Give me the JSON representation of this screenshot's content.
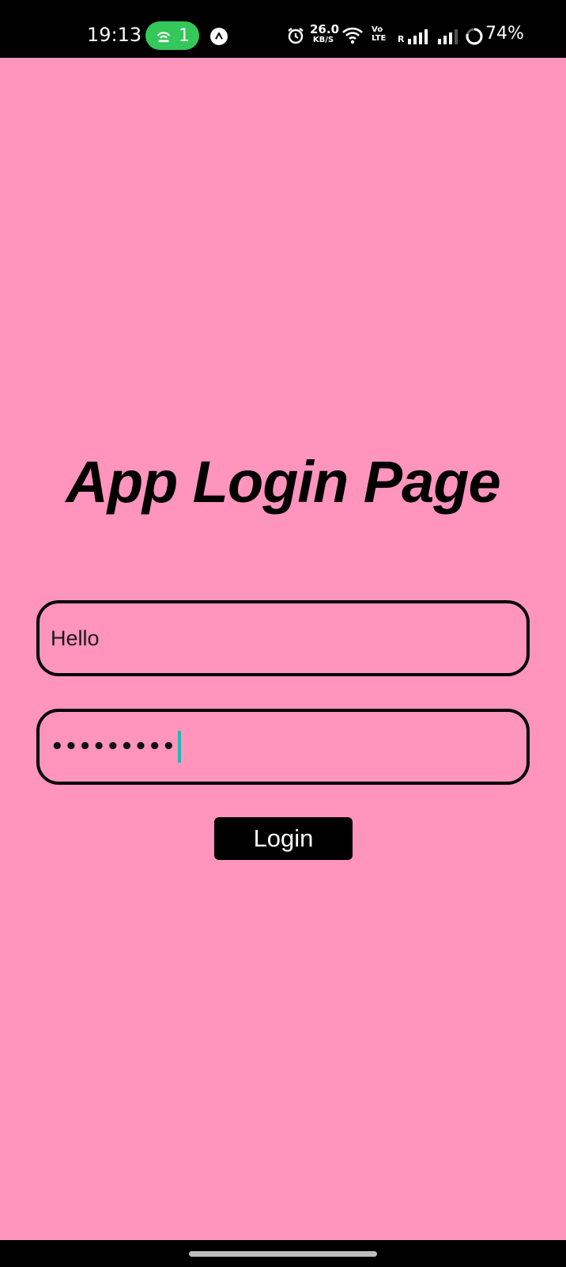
{
  "status_bar": {
    "time": "19:13",
    "hotspot_count": "1",
    "net_speed_value": "26.0",
    "net_speed_unit": "KB/S",
    "volte_top": "Vo",
    "volte_bottom": "LTE",
    "roaming": "R",
    "battery": "74%",
    "hotspot_color": "#34c759"
  },
  "login": {
    "title": "App Login Page",
    "username_value": "Hello",
    "password_masked": "•••••••••",
    "login_label": "Login",
    "background_color": "#ff94bd",
    "caret_color": "#26b5b0"
  }
}
